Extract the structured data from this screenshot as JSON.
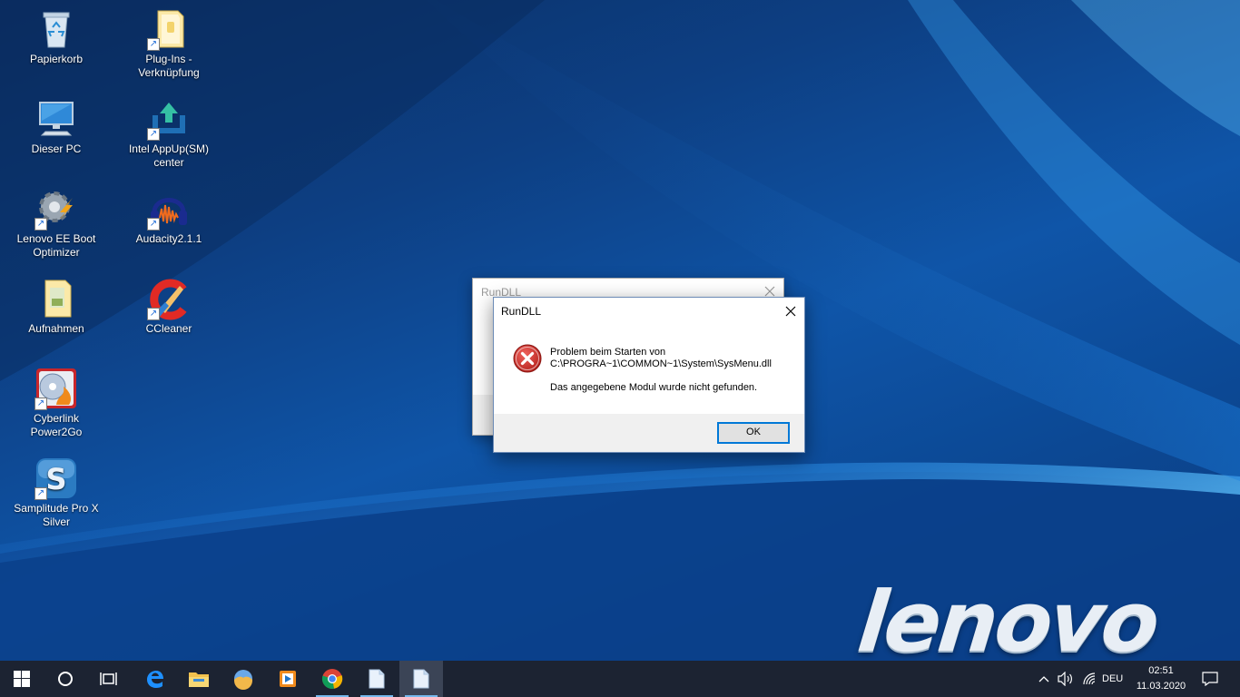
{
  "desktop": {
    "icons": [
      {
        "label": "Papierkorb"
      },
      {
        "label": "Plug-Ins - Verknüpfung"
      },
      {
        "label": "Dieser PC"
      },
      {
        "label": "Intel AppUp(SM) center"
      },
      {
        "label": "Lenovo EE Boot Optimizer"
      },
      {
        "label": "Audacity2.1.1"
      },
      {
        "label": "Aufnahmen"
      },
      {
        "label": "CCleaner"
      },
      {
        "label": "Cyberlink Power2Go"
      },
      {
        "label": "Samplitude Pro X Silver"
      }
    ],
    "wallpaper_brand": "lenovo"
  },
  "dialog_background": {
    "title": "RunDLL"
  },
  "dialog": {
    "title": "RunDLL",
    "message_line1": "Problem beim Starten von",
    "message_line2": "C:\\PROGRA~1\\COMMON~1\\System\\SysMenu.dll",
    "message_line3": "Das angegebene Modul wurde nicht gefunden.",
    "ok_label": "OK",
    "icon": "error-icon"
  },
  "taskbar": {
    "apps": [
      "start-icon",
      "search-icon",
      "task-view-icon",
      "edge-icon",
      "file-explorer-icon",
      "photos-icon",
      "media-player-icon",
      "chrome-icon",
      "document-icon",
      "document-icon"
    ],
    "language": "DEU",
    "time": "02:51",
    "date": "11.03.2020"
  },
  "colors": {
    "taskbar_bg": "#1c2332",
    "accent": "#0078d7",
    "error_red": "#c4302b"
  }
}
